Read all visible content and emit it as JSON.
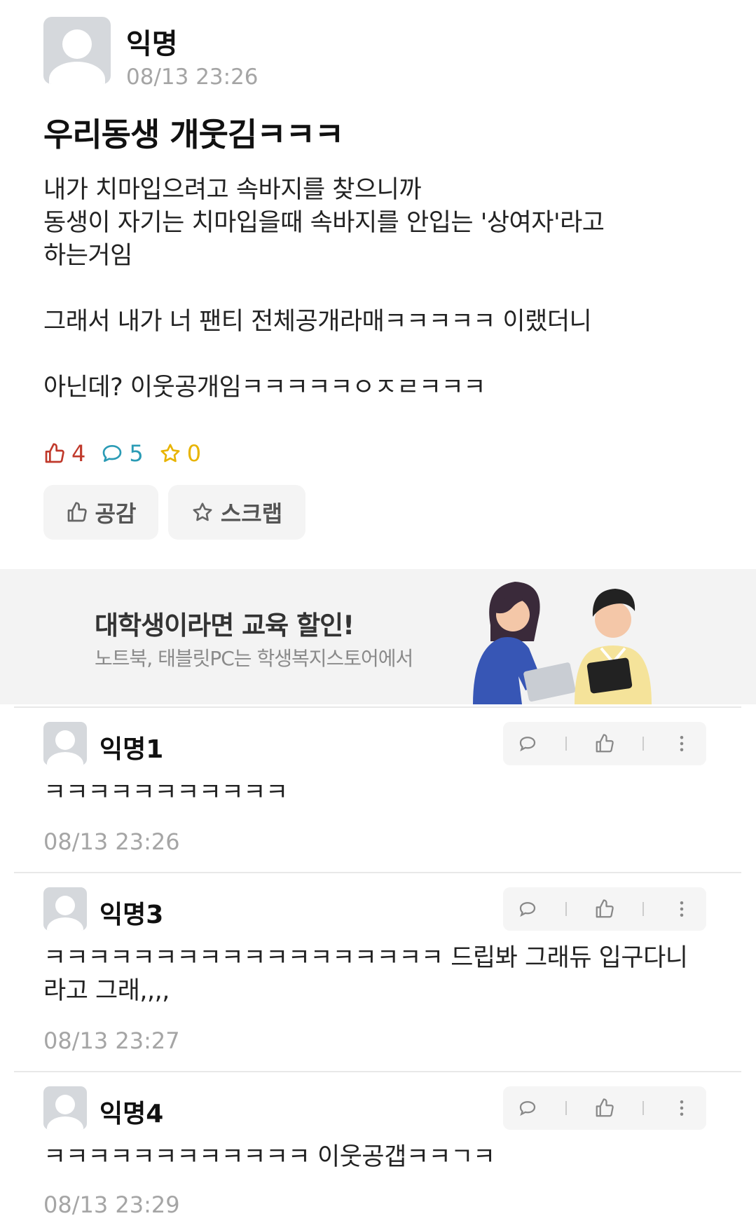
{
  "post": {
    "author": "익명",
    "time": "08/13 23:26",
    "title": "우리동생 개웃김ㅋㅋㅋ",
    "body": "내가 치마입으려고 속바지를 찾으니까\n동생이 자기는 치마입을때 속바지를 안입는 '상여자'라고\n하는거임\n\n그래서 내가 너 팬티 전체공개라매ㅋㅋㅋㅋㅋ 이랬더니\n\n아닌데? 이웃공개임ㅋㅋㅋㅋㅋㅇㅈㄹㅋㅋㅋ",
    "likes": "4",
    "comments": "5",
    "scraps": "0",
    "like_button": "공감",
    "scrap_button": "스크랩"
  },
  "ad": {
    "title": "대학생이라면 교육 할인!",
    "subtitle": "노트북, 태블릿PC는 학생복지스토어에서"
  },
  "comments": [
    {
      "author": "익명1",
      "text": "ㅋㅋㅋㅋㅋㅋㅋㅋㅋㅋㅋ",
      "time": "08/13 23:26"
    },
    {
      "author": "익명3",
      "text": "ㅋㅋㅋㅋㅋㅋㅋㅋㅋㅋㅋㅋㅋㅋㅋㅋㅋㅋ 드립봐  그래듀 입구다니라고 그래,,,,",
      "time": "08/13 23:27"
    },
    {
      "author": "익명4",
      "text": "ㅋㅋㅋㅋㅋㅋㅋㅋㅋㅋㅋㅋ 이웃공갭ㅋㅋㄱㅋ",
      "time": "08/13 23:29"
    }
  ],
  "colors": {
    "like": "#c0392b",
    "comment": "#2a9bb5",
    "scrap": "#e8b400",
    "muted": "#a5a5a5"
  }
}
